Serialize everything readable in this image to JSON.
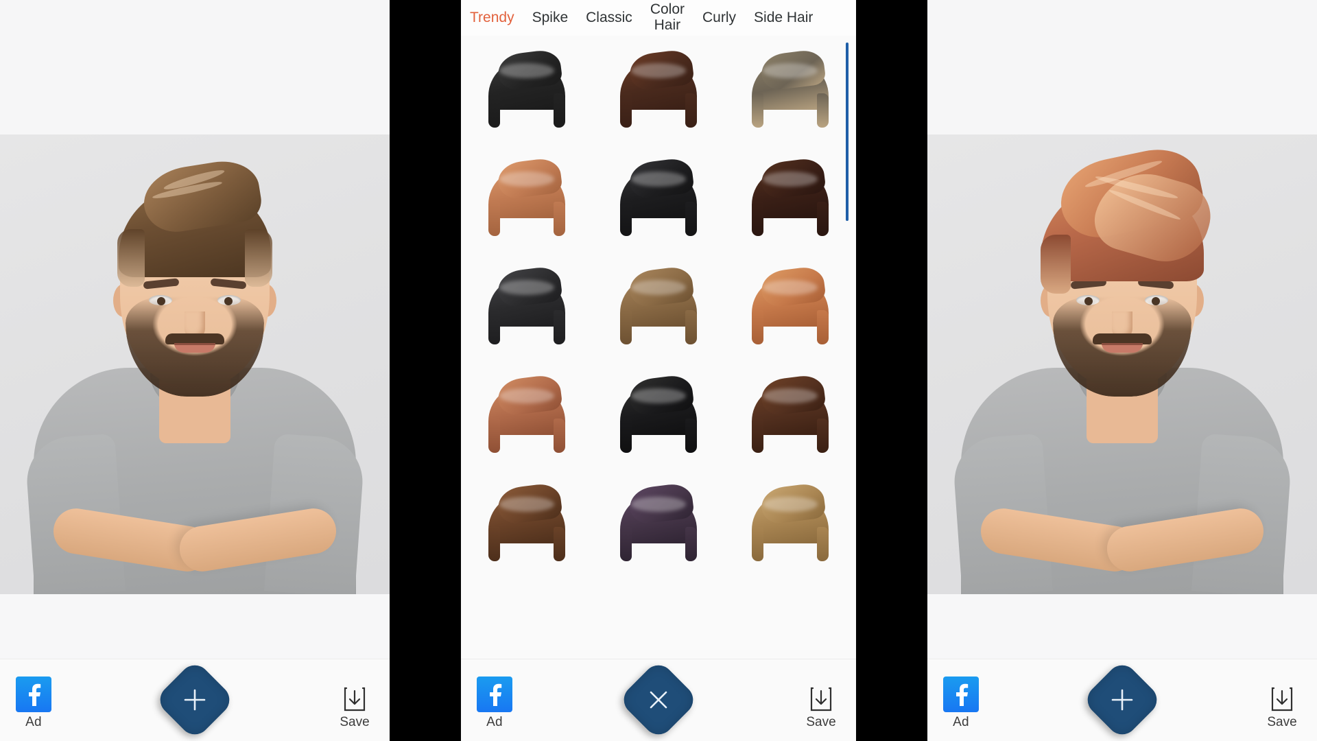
{
  "app": {
    "accent_orange": "#e2613c",
    "accent_blue": "#1f4d78",
    "facebook_blue": "#1877f2",
    "scrollbar_blue": "#1f5fa8",
    "panel_background": "#fafafa",
    "gutter_color": "#000000"
  },
  "panels": [
    {
      "id": "before",
      "role": "photo-editor",
      "subject": "bearded man with arms crossed in gray t-shirt",
      "hair_style": "natural brown textured quiff",
      "hair_color": "#6d4f33"
    },
    {
      "id": "picker",
      "role": "hairstyle-picker"
    },
    {
      "id": "after",
      "role": "photo-editor",
      "subject": "bearded man with arms crossed in gray t-shirt",
      "hair_style": "auburn swept quiff applied",
      "hair_color": "#b9694a"
    }
  ],
  "tabs": [
    {
      "label": "Trendy",
      "active": true
    },
    {
      "label": "Spike",
      "active": false
    },
    {
      "label": "Classic",
      "active": false
    },
    {
      "label": "Color\nHair",
      "active": false
    },
    {
      "label": "Curly",
      "active": false
    },
    {
      "label": "Side Hair",
      "active": false
    }
  ],
  "hairstyle_grid": {
    "columns": 3,
    "visible_rows": 5,
    "items": [
      {
        "index": 1,
        "name": "black-textured-crop",
        "base": "#232323",
        "top": "#3b3b3b",
        "side": "#1b1b1b"
      },
      {
        "index": 2,
        "name": "dark-brown-messy-quiff",
        "base": "#4a2a1d",
        "top": "#6b3b26",
        "side": "#3a2016"
      },
      {
        "index": 3,
        "name": "ash-blonde-fade-comb",
        "base": "#6d6455",
        "top": "#8b7f67",
        "side": "#b9a381"
      },
      {
        "index": 4,
        "name": "copper-swept-quiff",
        "base": "#c07a52",
        "top": "#dd9a6c",
        "side": "#a4643f"
      },
      {
        "index": 5,
        "name": "black-wavy-pompadour",
        "base": "#1d1d1f",
        "top": "#333336",
        "side": "#141415"
      },
      {
        "index": 6,
        "name": "espresso-slick-back",
        "base": "#3a1f16",
        "top": "#53301f",
        "side": "#2a1610"
      },
      {
        "index": 7,
        "name": "charcoal-side-part",
        "base": "#2b2b2d",
        "top": "#434346",
        "side": "#1e1e20"
      },
      {
        "index": 8,
        "name": "light-brown-comb-over",
        "base": "#8a6a45",
        "top": "#a8855c",
        "side": "#6d5132"
      },
      {
        "index": 9,
        "name": "ginger-curly-top",
        "base": "#c6794a",
        "top": "#dd9a63",
        "side": "#a85f36"
      },
      {
        "index": 10,
        "name": "auburn-layered-swoop",
        "base": "#b06a4a",
        "top": "#d08b62",
        "side": "#8f5035"
      },
      {
        "index": 11,
        "name": "black-spiky-textured",
        "base": "#1a1a1c",
        "top": "#30302f",
        "side": "#101011"
      },
      {
        "index": 12,
        "name": "mahogany-curly-fringe",
        "base": "#53301f",
        "top": "#6e4127",
        "side": "#3b2013"
      },
      {
        "index": 13,
        "name": "warm-brown-wavy-quiff",
        "base": "#6a4228",
        "top": "#8a5a38",
        "side": "#4d2f1b"
      },
      {
        "index": 14,
        "name": "violet-black-pompadour",
        "base": "#453548",
        "top": "#5b4560",
        "side": "#2f2433"
      },
      {
        "index": 15,
        "name": "golden-blonde-quiff",
        "base": "#a98552",
        "top": "#c9a772",
        "side": "#8a6a3d"
      }
    ]
  },
  "scrollbar": {
    "name": "vertical-scrollbar",
    "position": "top"
  },
  "action_bar": {
    "ad_label": "Ad",
    "save_label": "Save",
    "facebook_icon": "facebook-icon",
    "save_icon": "download-tray-icon",
    "primary_add_icon": "plus-icon",
    "primary_close_icon": "close-x-icon"
  }
}
